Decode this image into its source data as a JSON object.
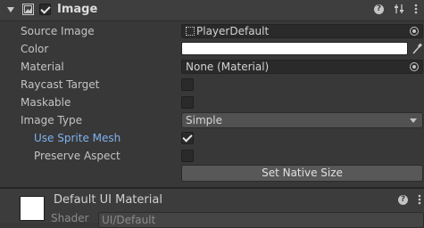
{
  "component": {
    "title": "Image",
    "enabled": true,
    "header_icons": [
      "help-icon",
      "preset-icon",
      "more-icon"
    ]
  },
  "fields": {
    "source_image": {
      "label": "Source Image",
      "value": "PlayerDefault"
    },
    "color": {
      "label": "Color",
      "value": "#FFFFFF"
    },
    "material": {
      "label": "Material",
      "value": "None (Material)"
    },
    "raycast_target": {
      "label": "Raycast Target",
      "checked": false
    },
    "maskable": {
      "label": "Maskable",
      "checked": false
    },
    "image_type": {
      "label": "Image Type",
      "value": "Simple"
    },
    "use_sprite_mesh": {
      "label": "Use Sprite Mesh",
      "checked": true
    },
    "preserve_aspect": {
      "label": "Preserve Aspect",
      "checked": false
    }
  },
  "actions": {
    "set_native_size": "Set Native Size"
  },
  "material_section": {
    "title": "Default UI Material",
    "shader_label": "Shader",
    "shader_value": "UI/Default"
  },
  "colors": {
    "background": "#383838",
    "accent_label": "#7FB2EF",
    "checkbox": "#2A2A2A"
  }
}
